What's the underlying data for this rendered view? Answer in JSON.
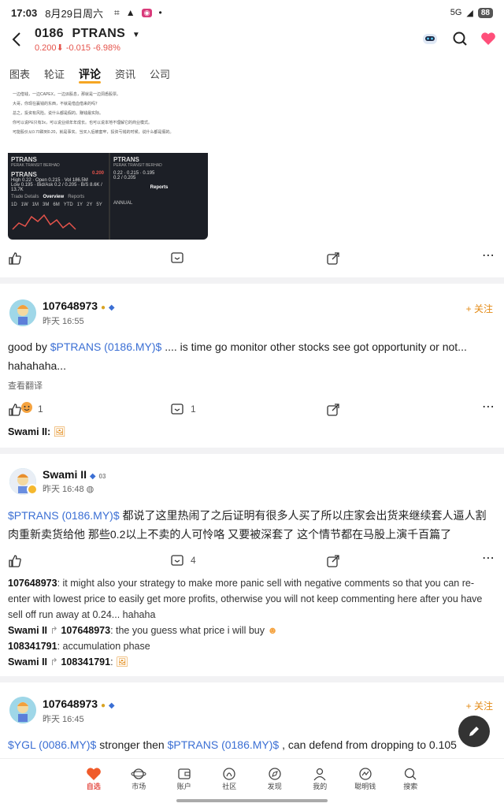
{
  "status_bar": {
    "time": "17:03",
    "date": "8月29日周六",
    "battery": "88",
    "signal": "5G"
  },
  "header": {
    "code": "0186",
    "name": "PTRANS",
    "price": "0.200",
    "change": "-0.015",
    "change_pct": "-6.98%"
  },
  "tabs": [
    "图表",
    "轮证",
    "评论",
    "资讯",
    "公司"
  ],
  "image_card": {
    "lines": [
      "一边借钱，一边CAPEX，一边派股息，那就是一边洞悉股票。",
      "大哥，你现在赢钱的东西，不就是借血借来的吗？",
      "总之，投资有风险。说什么都是假的。赚钱最实际。",
      "你可以说PE只有3x，可以说业绩年年成长。也可以说本地不理解它的商业模式。",
      "可能股价从0.70跌到0.20，就是事实。当买入后被套牢，投资亏钱的时候，说什么都是假的。"
    ],
    "left": {
      "ticker": "PTRANS",
      "sub": "PERAK TRANSIT BERHAD",
      "price": "0.200",
      "high": "0.22",
      "open": "0.215",
      "low": "0.195",
      "vol": "186.5M",
      "bidask": "0.2 / 0.205",
      "bs": "8.6K / 13.7K",
      "tab1": "Trade Details",
      "tab2": "Overview",
      "tab3": "Reports",
      "periods": [
        "1D",
        "1W",
        "1M",
        "3M",
        "6M",
        "YTD",
        "1Y",
        "2Y",
        "5Y"
      ]
    },
    "right": {
      "ticker": "PTRANS",
      "sub": "PERAK TRANSIT BERHAD",
      "tab": "Reports",
      "annual": "ANNUAL"
    }
  },
  "posts": [
    {
      "user": "107648973",
      "time": "昨天 16:55",
      "follow": "+ 关注",
      "text_prefix": "good by ",
      "mention": "$PTRANS (0186.MY)$",
      "text_suffix": " .... is time go monitor other stocks see got opportunity or not... hahahaha...",
      "translate": "查看翻译",
      "likes": "1",
      "reply_preview_user": "Swami II:"
    },
    {
      "user": "Swami II",
      "level": "03",
      "time": "昨天 16:48",
      "mention": "$PTRANS (0186.MY)$",
      "text": " 都说了这里热闹了之后证明有很多人买了所以庄家会出货来继续套人逼人割肉重新卖货给他 那些0.2以上不卖的人可怜咯 又要被深套了 这个情节都在马股上演千百篇了",
      "comments": "4",
      "replies": [
        {
          "from": "107648973",
          "to": "",
          "text": ": it might also your strategy to make more panic sell with negative comments so that you can re-enter with lowest price to easily get more profits, otherwise you will not keep commenting here after you have sell off run away at 0.24... hahaha"
        },
        {
          "from": "Swami II",
          "to": "107648973",
          "text": ": the you guess what price i will buy"
        },
        {
          "from": "108341791",
          "to": "",
          "text": ": accumulation phase"
        },
        {
          "from": "Swami II",
          "to": "108341791",
          "text": ":"
        }
      ]
    },
    {
      "user": "107648973",
      "time": "昨天 16:45",
      "follow": "+ 关注",
      "mention1": "$YGL (0086.MY)$",
      "mid": "  stronger then ",
      "mention2": "$PTRANS (0186.MY)$",
      "text": " , can defend from dropping to 0.105"
    }
  ],
  "bottom_nav": [
    "自选",
    "市场",
    "账户",
    "社区",
    "发现",
    "我的",
    "聪明钱",
    "搜索"
  ],
  "colors": {
    "accent": "#e38a16",
    "down": "#e5534b",
    "link": "#3b6fd4"
  }
}
